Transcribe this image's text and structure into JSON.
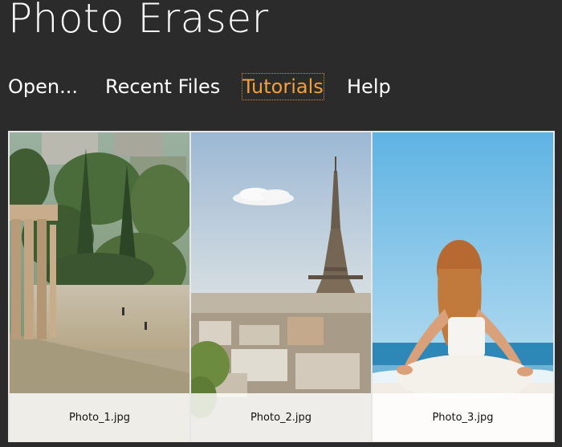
{
  "app": {
    "title": "Photo Eraser"
  },
  "menu": {
    "items": [
      {
        "label": "Open..."
      },
      {
        "label": "Recent Files"
      },
      {
        "label": "Tutorials",
        "active": true
      },
      {
        "label": "Help"
      }
    ]
  },
  "gallery": {
    "photos": [
      {
        "name": "Photo_1.jpg",
        "subject": "ruins-park-photo"
      },
      {
        "name": "Photo_2.jpg",
        "subject": "eiffel-tower-photo"
      },
      {
        "name": "Photo_3.jpg",
        "subject": "beach-yoga-photo"
      }
    ]
  },
  "colors": {
    "background": "#2b2b2b",
    "text": "#ffffff",
    "accent": "#f0a03c"
  }
}
